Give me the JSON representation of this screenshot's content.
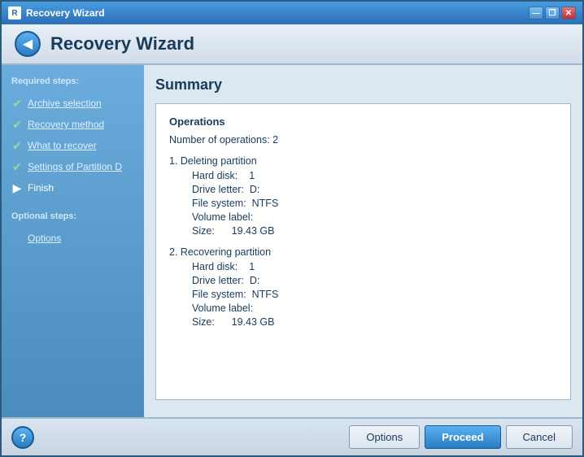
{
  "window": {
    "title": "Recovery Wizard",
    "controls": {
      "minimize": "—",
      "restore": "❐",
      "close": "✕"
    }
  },
  "header": {
    "title": "Recovery Wizard",
    "back_icon": "◀"
  },
  "sidebar": {
    "required_label": "Required steps:",
    "optional_label": "Optional steps:",
    "items": [
      {
        "id": "archive-selection",
        "label": "Archive selection",
        "state": "done"
      },
      {
        "id": "recovery-method",
        "label": "Recovery method",
        "state": "done"
      },
      {
        "id": "what-to-recover",
        "label": "What to recover",
        "state": "done"
      },
      {
        "id": "settings-partition-d",
        "label": "Settings of Partition D",
        "state": "done"
      },
      {
        "id": "finish",
        "label": "Finish",
        "state": "current"
      }
    ],
    "optional_items": [
      {
        "id": "options",
        "label": "Options",
        "state": "optional"
      }
    ]
  },
  "main": {
    "title": "Summary",
    "summary": {
      "operations_label": "Operations",
      "num_operations_label": "Number of operations:",
      "num_operations_value": "2",
      "operations": [
        {
          "title": "1. Deleting partition",
          "fields": [
            {
              "label": "Hard disk:",
              "value": "1"
            },
            {
              "label": "Drive letter:",
              "value": "D:"
            },
            {
              "label": "File system:",
              "value": "NTFS"
            },
            {
              "label": "Volume label:",
              "value": ""
            },
            {
              "label": "Size:",
              "value": "19.43 GB"
            }
          ]
        },
        {
          "title": "2. Recovering partition",
          "fields": [
            {
              "label": "Hard disk:",
              "value": "1"
            },
            {
              "label": "Drive letter:",
              "value": "D:"
            },
            {
              "label": "File system:",
              "value": "NTFS"
            },
            {
              "label": "Volume label:",
              "value": ""
            },
            {
              "label": "Size:",
              "value": "19.43 GB"
            }
          ]
        }
      ]
    }
  },
  "footer": {
    "help_icon": "?",
    "buttons": {
      "options": "Options",
      "proceed": "Proceed",
      "cancel": "Cancel"
    }
  }
}
